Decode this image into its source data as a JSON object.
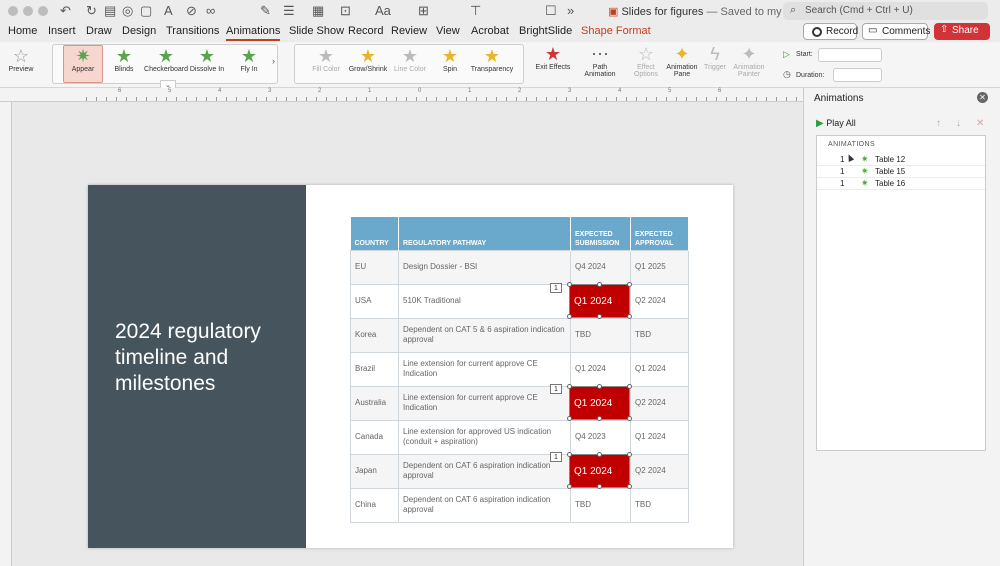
{
  "window": {
    "doc_title": "Slides for figures",
    "save_status": "— Saved to my Mac",
    "search_placeholder": "Search (Cmd + Ctrl + U)"
  },
  "tabs": [
    "Home",
    "Insert",
    "Draw",
    "Design",
    "Transitions",
    "Animations",
    "Slide Show",
    "Record",
    "Review",
    "View",
    "Acrobat",
    "BrightSlide",
    "Shape Format"
  ],
  "active_tab": "Animations",
  "header_buttons": {
    "record": "Record",
    "comments": "Comments",
    "share": "Share"
  },
  "ribbon": {
    "preview": "Preview",
    "entrance_effects": [
      "Appear",
      "Blinds",
      "Checkerboard",
      "Dissolve In",
      "Fly In"
    ],
    "emphasis_effects": [
      "Fill Color",
      "Grow/Shrink",
      "Line Color",
      "Spin",
      "Transparency"
    ],
    "exit_effects": "Exit Effects",
    "path_animation": "Path Animation",
    "effect_options": "Effect Options",
    "animation_pane": "Animation Pane",
    "trigger": "Trigger",
    "animation_painter": "Animation Painter",
    "start_label": "Start:",
    "duration_label": "Duration:"
  },
  "ruler_numbers": [
    "6",
    "5",
    "4",
    "3",
    "2",
    "1",
    "0",
    "1",
    "2",
    "3",
    "4",
    "5",
    "6"
  ],
  "slide": {
    "title": "2024 regulatory timeline and milestones",
    "table": {
      "headers": [
        "COUNTRY",
        "REGULATORY PATHWAY",
        "EXPECTED SUBMISSION",
        "EXPECTED APPROVAL"
      ],
      "rows": [
        [
          "EU",
          "Design Dossier - BSI",
          "Q4 2024",
          "Q1 2025"
        ],
        [
          "USA",
          "510K Traditional",
          "",
          "Q2 2024"
        ],
        [
          "Korea",
          "Dependent on CAT 5 & 6 aspiration indication approval",
          "TBD",
          "TBD"
        ],
        [
          "Brazil",
          "Line extension for current approve CE Indication",
          "Q1 2024",
          "Q1 2024"
        ],
        [
          "Australia",
          "Line extension for current approve CE Indication",
          "",
          "Q2 2024"
        ],
        [
          "Canada",
          "Line extension for approved US indication (conduit + aspiration)",
          "Q4 2023",
          "Q1 2024"
        ],
        [
          "Japan",
          "Dependent on CAT 6 aspiration indication approval",
          "",
          "Q2 2024"
        ],
        [
          "China",
          "Dependent on CAT 6 aspiration indication approval",
          "TBD",
          "TBD"
        ]
      ]
    },
    "highlight_boxes": [
      {
        "text": "Q1 2024",
        "tag": "1"
      },
      {
        "text": "Q1 2024",
        "tag": "1"
      },
      {
        "text": "Q1 2024",
        "tag": "1"
      }
    ],
    "highlight_color": "#c00000"
  },
  "animation_pane": {
    "title": "Animations",
    "play_all": "Play All",
    "list_header": "ANIMATIONS",
    "items": [
      {
        "num": "1",
        "name": "Table 12"
      },
      {
        "num": "1",
        "name": "Table 15"
      },
      {
        "num": "1",
        "name": "Table 16"
      }
    ]
  },
  "colors": {
    "accent": "#c43e1c",
    "table_header": "#6aa8cc",
    "slide_panel": "#45545d",
    "share": "#d13438"
  }
}
